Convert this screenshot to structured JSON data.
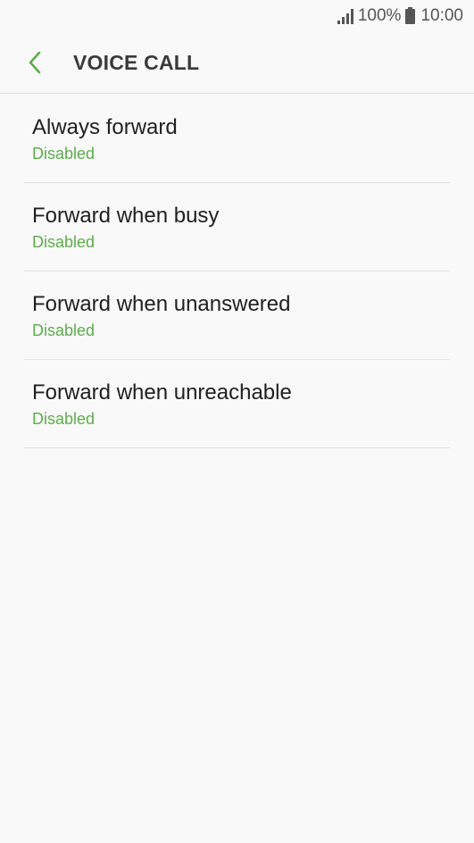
{
  "status_bar": {
    "battery_text": "100%",
    "time": "10:00",
    "icons": [
      "signal-icon",
      "battery-icon"
    ]
  },
  "header": {
    "title": "VOICE CALL",
    "back_icon": "chevron-left-icon",
    "accent_color": "#5cad4b"
  },
  "items": [
    {
      "title": "Always forward",
      "status": "Disabled"
    },
    {
      "title": "Forward when busy",
      "status": "Disabled"
    },
    {
      "title": "Forward when unanswered",
      "status": "Disabled"
    },
    {
      "title": "Forward when unreachable",
      "status": "Disabled"
    }
  ]
}
